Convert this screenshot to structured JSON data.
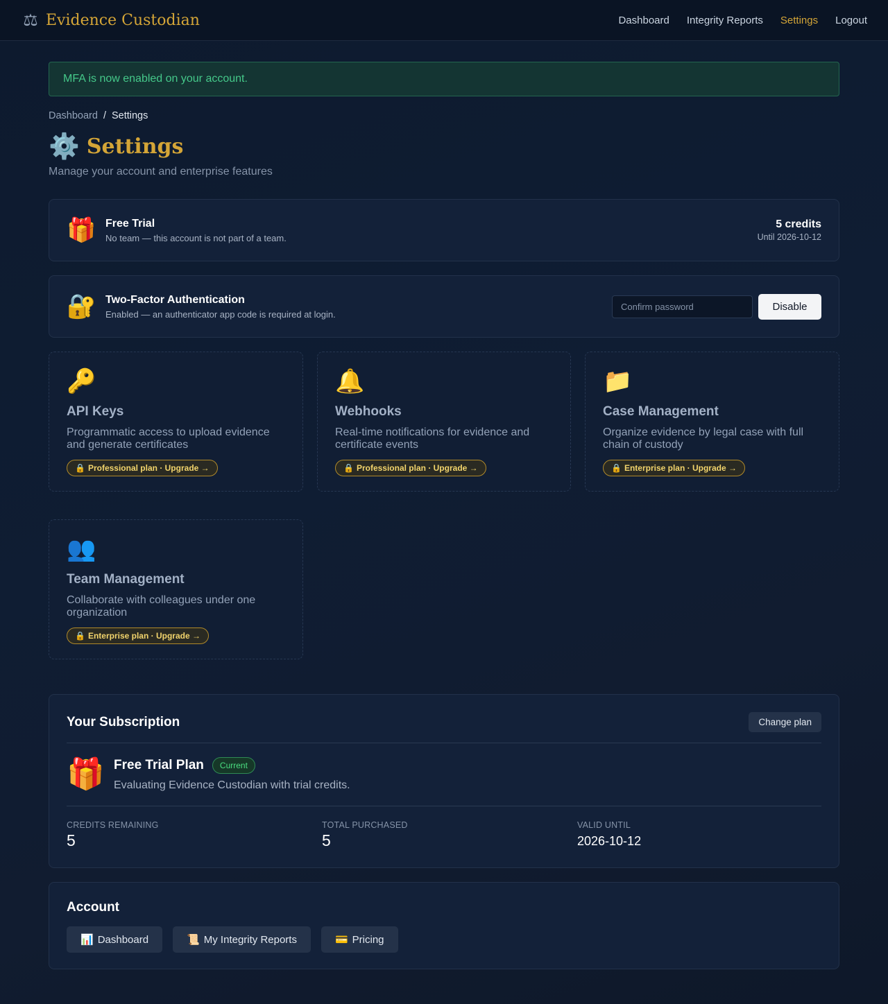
{
  "nav": {
    "brand_icon": "scales-icon",
    "brand_name": "Evidence Custodian",
    "links": [
      "Dashboard",
      "Integrity Reports",
      "Settings",
      "Logout"
    ],
    "active": "Settings"
  },
  "alert": {
    "message": "MFA is now enabled on your account."
  },
  "breadcrumb": {
    "root": "Dashboard",
    "sep": "/",
    "current": "Settings"
  },
  "page": {
    "title": "Settings",
    "subtitle": "Manage your account and enterprise features"
  },
  "trial": {
    "title": "Free Trial",
    "desc": "No team — this account is not part of a team.",
    "credits": "5 credits",
    "until": "Until 2026-10-12"
  },
  "mfa": {
    "title": "Two-Factor Authentication",
    "desc": "Enabled — an authenticator app code is required at login.",
    "password_placeholder": "Confirm password",
    "password_value": "",
    "disable_label": "Disable"
  },
  "features": [
    {
      "icon": "key-icon",
      "glyph": "🔑",
      "title": "API Keys",
      "desc": "Programmatic access to upload evidence and generate certificates",
      "badge": "Professional plan · Upgrade →"
    },
    {
      "icon": "bell-icon",
      "glyph": "🔔",
      "title": "Webhooks",
      "desc": "Real-time notifications for evidence and certificate events",
      "badge": "Professional plan · Upgrade →"
    },
    {
      "icon": "folder-icon",
      "glyph": "📁",
      "title": "Case Management",
      "desc": "Organize evidence by legal case with full chain of custody",
      "badge": "Enterprise plan · Upgrade →"
    },
    {
      "icon": "team-icon",
      "glyph": "👥",
      "title": "Team Management",
      "desc": "Collaborate with colleagues under one organization",
      "badge": "Enterprise plan · Upgrade →"
    }
  ],
  "subscription": {
    "heading": "Your Subscription",
    "change_label": "Change plan",
    "plan_name": "Free Trial Plan",
    "current_label": "Current",
    "plan_desc": "Evaluating Evidence Custodian with trial credits.",
    "stats": [
      {
        "label": "Credits Remaining",
        "value": "5"
      },
      {
        "label": "Total Purchased",
        "value": "5"
      },
      {
        "label": "Valid Until",
        "value": "2026-10-12"
      }
    ]
  },
  "account": {
    "heading": "Account",
    "links": [
      {
        "icon": "chart-icon",
        "glyph": "📊",
        "label": "Dashboard"
      },
      {
        "icon": "scroll-icon",
        "glyph": "📜",
        "label": "My Integrity Reports"
      },
      {
        "icon": "card-icon",
        "glyph": "💳",
        "label": "Pricing"
      }
    ]
  },
  "colors": {
    "accent": "#d4a537",
    "success": "#45c98a",
    "background": "#0f1d33"
  }
}
